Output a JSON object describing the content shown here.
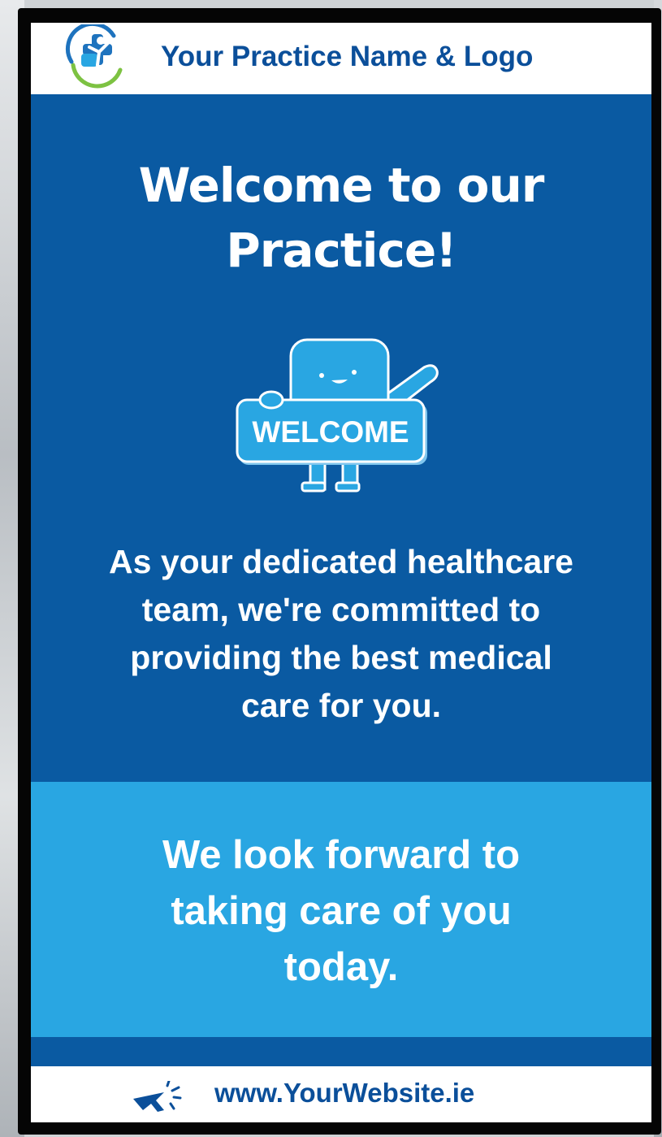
{
  "header": {
    "practice_name": "Your Practice Name & Logo",
    "logo_icon": "medical-cross-person-logo"
  },
  "main": {
    "title_line1": "Welcome to our",
    "title_line2": "Practice!",
    "mascot_sign": "WELCOME",
    "body_line1": "As your dedicated healthcare",
    "body_line2": "team, we're committed to",
    "body_line3": "providing the best medical",
    "body_line4": "care for you."
  },
  "closing": {
    "line1": "We look forward to",
    "line2": "taking care of you",
    "line3": "today."
  },
  "footer": {
    "website": "www.YourWebsite.ie",
    "cursor_icon": "cursor-click-icon"
  },
  "colors": {
    "primary_blue": "#0a5aa2",
    "light_blue": "#29a6e2",
    "logo_text_blue": "#0b4f9a",
    "logo_green": "#7dc242",
    "white": "#ffffff",
    "bezel": "#050505"
  }
}
